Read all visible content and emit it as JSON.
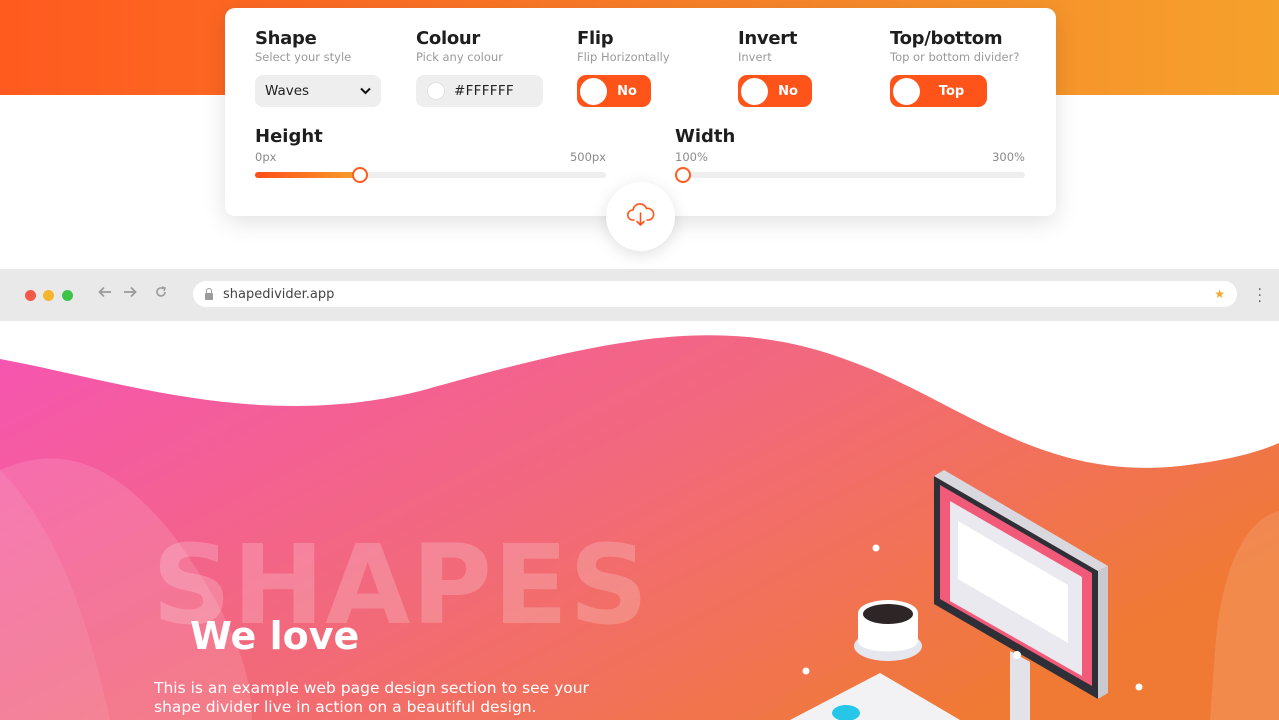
{
  "panel": {
    "shape": {
      "label": "Shape",
      "sub": "Select your style",
      "value": "Waves"
    },
    "colour": {
      "label": "Colour",
      "sub": "Pick any colour",
      "value": "#FFFFFF"
    },
    "flip": {
      "label": "Flip",
      "sub": "Flip Horizontally",
      "state": "No"
    },
    "invert": {
      "label": "Invert",
      "sub": "Invert",
      "state": "No"
    },
    "topbottom": {
      "label": "Top/bottom",
      "sub": "Top or bottom divider?",
      "state": "Top"
    },
    "height": {
      "label": "Height",
      "min": "0px",
      "max": "500px",
      "value_fraction": 0.3
    },
    "width": {
      "label": "Width",
      "min": "100%",
      "max": "300%",
      "value_fraction": 0.0
    }
  },
  "browser": {
    "url": "shapedivider.app"
  },
  "hero": {
    "big_word": "SHAPES",
    "heading": "We love",
    "line1": "This is an example web page design section to see your",
    "line2": "shape divider live in action on a beautiful design."
  },
  "colors": {
    "accent": "#ff5419",
    "hero_start": "#f654b4",
    "hero_end": "#f07a33"
  },
  "icons": [
    "chevron-down-icon",
    "cloud-download-icon",
    "back-arrow-icon",
    "forward-arrow-icon",
    "reload-icon",
    "lock-icon",
    "star-icon",
    "kebab-menu-icon"
  ]
}
